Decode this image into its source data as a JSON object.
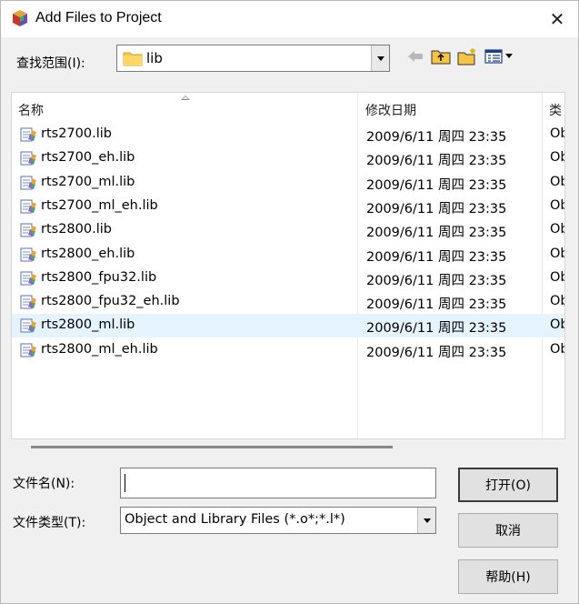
{
  "window": {
    "title": "Add Files to Project",
    "close_glyph": "✕"
  },
  "lookin": {
    "label": "查找范围(I):",
    "value": "lib"
  },
  "toolbar": {
    "back_icon": "back-arrow-icon",
    "up_icon": "up-folder-icon",
    "new_folder_icon": "new-folder-icon",
    "view_icon": "view-menu-icon"
  },
  "columns": {
    "name": "名称",
    "date": "修改日期",
    "type": "类"
  },
  "files": [
    {
      "name": "rts2700.lib",
      "date": "2009/6/11 周四 23:35",
      "type": "Ob"
    },
    {
      "name": "rts2700_eh.lib",
      "date": "2009/6/11 周四 23:35",
      "type": "Ob"
    },
    {
      "name": "rts2700_ml.lib",
      "date": "2009/6/11 周四 23:35",
      "type": "Ob"
    },
    {
      "name": "rts2700_ml_eh.lib",
      "date": "2009/6/11 周四 23:35",
      "type": "Ob"
    },
    {
      "name": "rts2800.lib",
      "date": "2009/6/11 周四 23:35",
      "type": "Ob"
    },
    {
      "name": "rts2800_eh.lib",
      "date": "2009/6/11 周四 23:35",
      "type": "Ob"
    },
    {
      "name": "rts2800_fpu32.lib",
      "date": "2009/6/11 周四 23:35",
      "type": "Ob"
    },
    {
      "name": "rts2800_fpu32_eh.lib",
      "date": "2009/6/11 周四 23:35",
      "type": "Ob"
    },
    {
      "name": "rts2800_ml.lib",
      "date": "2009/6/11 周四 23:35",
      "type": "Ob"
    },
    {
      "name": "rts2800_ml_eh.lib",
      "date": "2009/6/11 周四 23:35",
      "type": "Ob"
    }
  ],
  "selected_index": 8,
  "filename": {
    "label": "文件名(N):",
    "value": ""
  },
  "filetype": {
    "label": "文件类型(T):",
    "value": "Object and Library Files (*.o*;*.l*)"
  },
  "buttons": {
    "open": "打开(O)",
    "cancel": "取消",
    "help": "帮助(H)"
  },
  "colors": {
    "selected_row": "#e5f3ff",
    "folder": "#f6c445"
  }
}
